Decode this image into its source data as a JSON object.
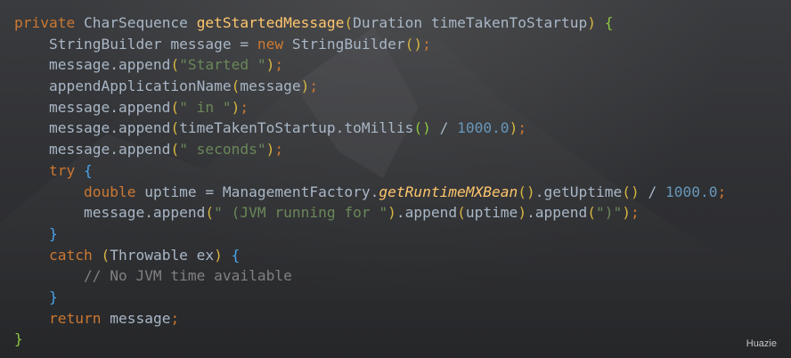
{
  "code": {
    "l1": {
      "kw": "private",
      "type": " CharSequence ",
      "fn": "getStartedMessage",
      "lp": "(",
      "params": "Duration timeTakenToStartup",
      "rp": ")",
      "sp": " ",
      "lb": "{"
    },
    "l2": {
      "a": "StringBuilder message = ",
      "kw": "new",
      "b": " StringBuilder",
      "lp": "(",
      "rp": ")",
      "semi": ";"
    },
    "l3": {
      "a": "message.append",
      "lp": "(",
      "str": "\"Started \"",
      "rp": ")",
      "semi": ";"
    },
    "l4": {
      "a": "appendApplicationName",
      "lp": "(",
      "b": "message",
      "rp": ")",
      "semi": ";"
    },
    "l5": {
      "a": "message.append",
      "lp": "(",
      "str": "\" in \"",
      "rp": ")",
      "semi": ";"
    },
    "l6": {
      "a": "message.append",
      "lp": "(",
      "b": "timeTakenToStartup.toMillis",
      "ilp": "(",
      "irp": ")",
      "op": " / ",
      "num": "1000.0",
      "rp": ")",
      "semi": ";"
    },
    "l7": {
      "a": "message.append",
      "lp": "(",
      "str": "\" seconds\"",
      "rp": ")",
      "semi": ";"
    },
    "l8": {
      "kw": "try",
      "sp": " ",
      "lb": "{"
    },
    "l9": {
      "kw": "double",
      "a": " uptime = ManagementFactory.",
      "fn": "getRuntimeMXBean",
      "lp1": "(",
      "rp1": ")",
      "b": ".getUptime",
      "lp2": "(",
      "rp2": ")",
      "op": " / ",
      "num": "1000.0",
      "semi": ";"
    },
    "l10": {
      "a": "message.append",
      "lp1": "(",
      "str1": "\" (JVM running for \"",
      "rp1": ")",
      "b": ".append",
      "lp2": "(",
      "c": "uptime",
      "rp2": ")",
      "d": ".append",
      "lp3": "(",
      "str2": "\")\"",
      "rp3": ")",
      "semi": ";"
    },
    "l11": {
      "rb": "}"
    },
    "l12": {
      "kw": "catch",
      "sp": " ",
      "lp": "(",
      "a": "Throwable ex",
      "rp": ")",
      "sp2": " ",
      "lb": "{"
    },
    "l13": {
      "cmt": "// No JVM time available"
    },
    "l14": {
      "rb": "}"
    },
    "l15": {
      "kw": "return",
      "a": " message",
      "semi": ";"
    },
    "l16": {
      "rb": "}"
    }
  },
  "watermark": "Huazie",
  "colors": {
    "keyword": "#cc7832",
    "method": "#ffc66d",
    "string": "#6a8759",
    "number": "#6897bb",
    "comment": "#808080",
    "text": "#a9b7c6"
  }
}
